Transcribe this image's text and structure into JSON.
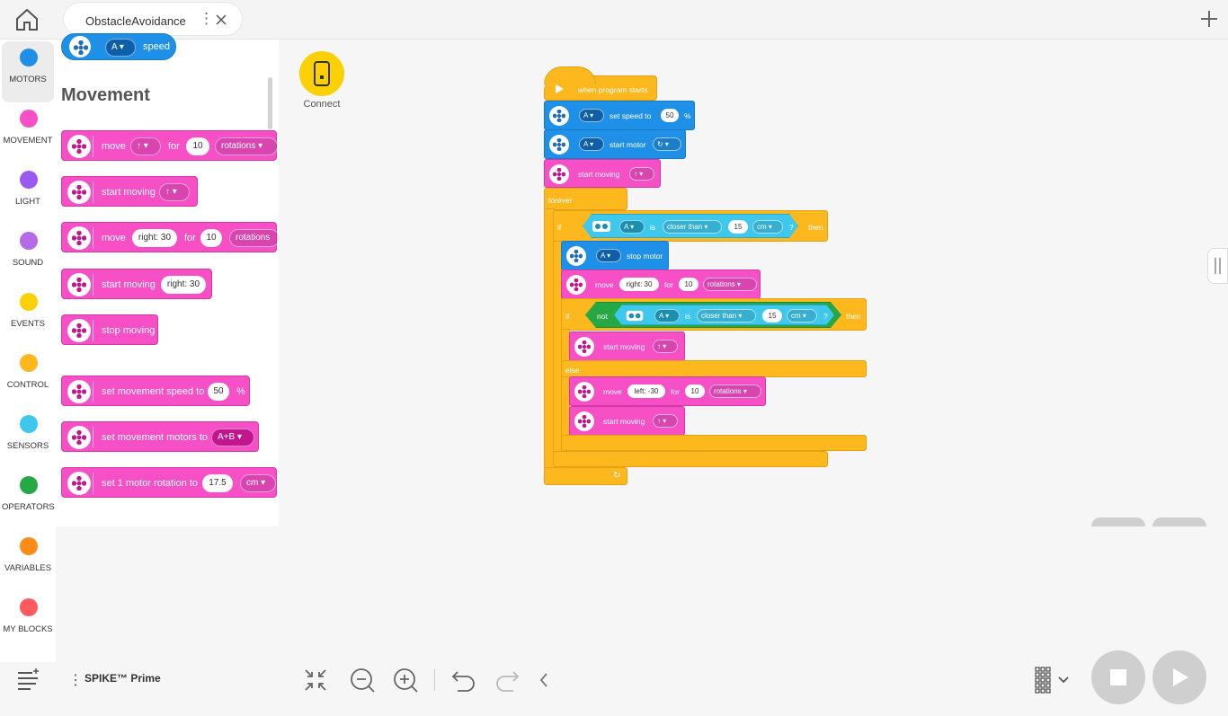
{
  "tab": {
    "title": "ObstacleAvoidance",
    "menu": "⋮"
  },
  "categories": [
    {
      "label": "MOTORS",
      "color": "#1f90e8"
    },
    {
      "label": "MOVEMENT",
      "color": "#f74fc6"
    },
    {
      "label": "LIGHT",
      "color": "#9a5cf0"
    },
    {
      "label": "SOUND",
      "color": "#b56ae8"
    },
    {
      "label": "EVENTS",
      "color": "#fdd003"
    },
    {
      "label": "CONTROL",
      "color": "#fdb81e"
    },
    {
      "label": "SENSORS",
      "color": "#3ec8ed"
    },
    {
      "label": "OPERATORS",
      "color": "#26a844"
    },
    {
      "label": "VARIABLES",
      "color": "#ff8c1a"
    },
    {
      "label": "MY BLOCKS",
      "color": "#ff5a5f"
    }
  ],
  "palette": {
    "top_block": {
      "port": "A",
      "label": "speed"
    },
    "title": "Movement",
    "blocks": {
      "move": {
        "label": "move",
        "dir": "↑",
        "for": "for",
        "value": "10",
        "unit": "rotations"
      },
      "start_moving": {
        "label": "start moving",
        "dir": "↑"
      },
      "move_steer": {
        "label": "move",
        "steer": "right: 30",
        "for": "for",
        "value": "10",
        "unit": "rotations"
      },
      "start_steer": {
        "label": "start moving",
        "steer": "right: 30"
      },
      "stop": {
        "label": "stop moving"
      },
      "set_speed": {
        "label": "set movement speed to",
        "value": "50",
        "unit": "%"
      },
      "set_motors": {
        "label": "set movement motors to",
        "value": "A+B"
      },
      "set_rotation": {
        "label": "set 1 motor rotation to",
        "value": "17.5",
        "unit": "cm"
      }
    }
  },
  "connect": {
    "label": "Connect"
  },
  "script": {
    "hat": "when program starts",
    "set_speed": {
      "port": "A",
      "label": "set speed to",
      "value": "50",
      "unit": "%"
    },
    "start_motor": {
      "port": "A",
      "label": "start motor",
      "dir": "↻"
    },
    "start_moving": {
      "label": "start moving",
      "dir": "↑"
    },
    "forever": "forever",
    "if1": {
      "if": "if",
      "port": "A",
      "is": "is",
      "cmp": "closer than",
      "value": "15",
      "unit": "cm",
      "q": "?",
      "then": "then"
    },
    "stop_motor": {
      "port": "A",
      "label": "stop motor"
    },
    "move1": {
      "label": "move",
      "steer": "right: 30",
      "for": "for",
      "value": "10",
      "unit": "rotations"
    },
    "if2": {
      "if": "if",
      "not": "not",
      "port": "A",
      "is": "is",
      "cmp": "closer than",
      "value": "15",
      "unit": "cm",
      "q": "?",
      "then": "then"
    },
    "start_moving2": {
      "label": "start moving",
      "dir": "↑"
    },
    "else": "else",
    "move2": {
      "label": "move",
      "steer": "left: -30",
      "for": "for",
      "value": "10",
      "unit": "rotations"
    },
    "start_moving3": {
      "label": "start moving",
      "dir": "↑"
    }
  },
  "hub": {
    "label": "SPIKE™ Prime",
    "menu": "⋮"
  }
}
